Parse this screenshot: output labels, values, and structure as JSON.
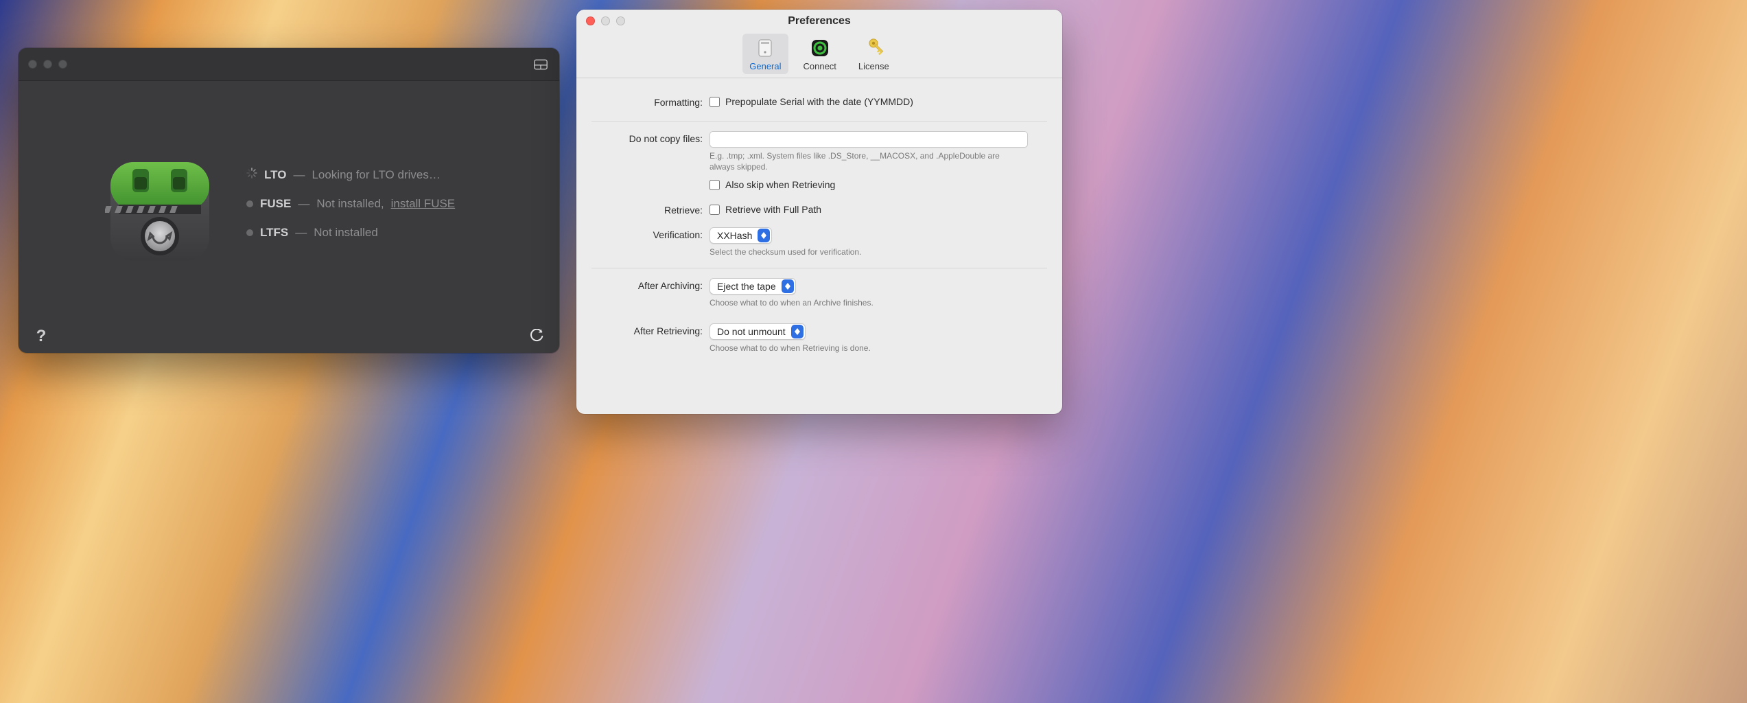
{
  "main": {
    "status": [
      {
        "icon": "spinner",
        "label": "LTO",
        "text": "Looking for LTO drives…"
      },
      {
        "icon": "dot",
        "label": "FUSE",
        "text": "Not installed,",
        "link": "install FUSE"
      },
      {
        "icon": "dot",
        "label": "LTFS",
        "text": "Not installed"
      }
    ]
  },
  "prefs": {
    "title": "Preferences",
    "tabs": {
      "general": "General",
      "connect": "Connect",
      "license": "License"
    },
    "formatting": {
      "label": "Formatting:",
      "checkbox": "Prepopulate Serial with the date (YYMMDD)"
    },
    "donotcopy": {
      "label": "Do not copy files:",
      "value": "",
      "help": "E.g. .tmp; .xml. System files like .DS_Store, __MACOSX, and .AppleDouble are always skipped.",
      "also_skip": "Also skip when Retrieving"
    },
    "retrieve": {
      "label": "Retrieve:",
      "checkbox": "Retrieve with Full Path"
    },
    "verification": {
      "label": "Verification:",
      "value": "XXHash",
      "help": "Select the checksum used for verification."
    },
    "after_arch": {
      "label": "After Archiving:",
      "value": "Eject the tape",
      "help": "Choose what to do when an Archive finishes."
    },
    "after_retr": {
      "label": "After Retrieving:",
      "value": "Do not unmount",
      "help": "Choose what to do when Retrieving is done."
    }
  }
}
